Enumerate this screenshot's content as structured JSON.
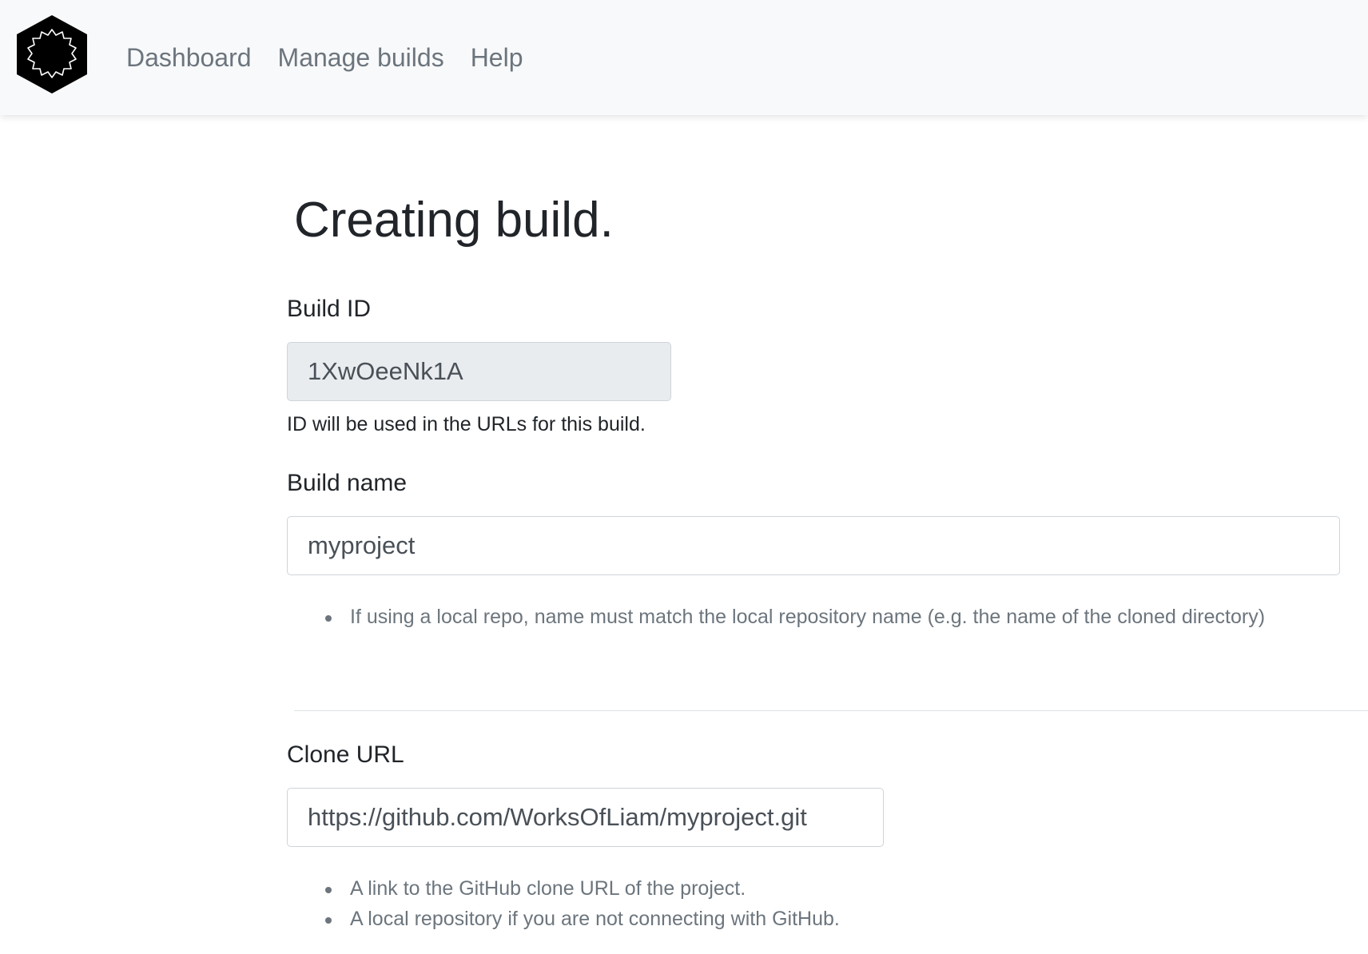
{
  "navbar": {
    "logo_icon": "gear-hexagon-logo-icon",
    "links": [
      "Dashboard",
      "Manage builds",
      "Help"
    ]
  },
  "page": {
    "title": "Creating build."
  },
  "form": {
    "build_id": {
      "label": "Build ID",
      "value": "1XwOeeNk1A",
      "help": "ID will be used in the URLs for this build."
    },
    "build_name": {
      "label": "Build name",
      "value": "myproject",
      "hints": [
        "If using a local repo, name must match the local repository name (e.g. the name of the cloned directory)"
      ]
    },
    "clone_url": {
      "label": "Clone URL",
      "value": "https://github.com/WorksOfLiam/myproject.git",
      "hints": [
        "A link to the GitHub clone URL of the project.",
        "A local repository if you are not connecting with GitHub."
      ]
    }
  },
  "colors": {
    "navbar_bg": "#f8f9fa",
    "nav_link": "#6c757d",
    "readonly_bg": "#e9ecef",
    "border": "#ced4da"
  }
}
